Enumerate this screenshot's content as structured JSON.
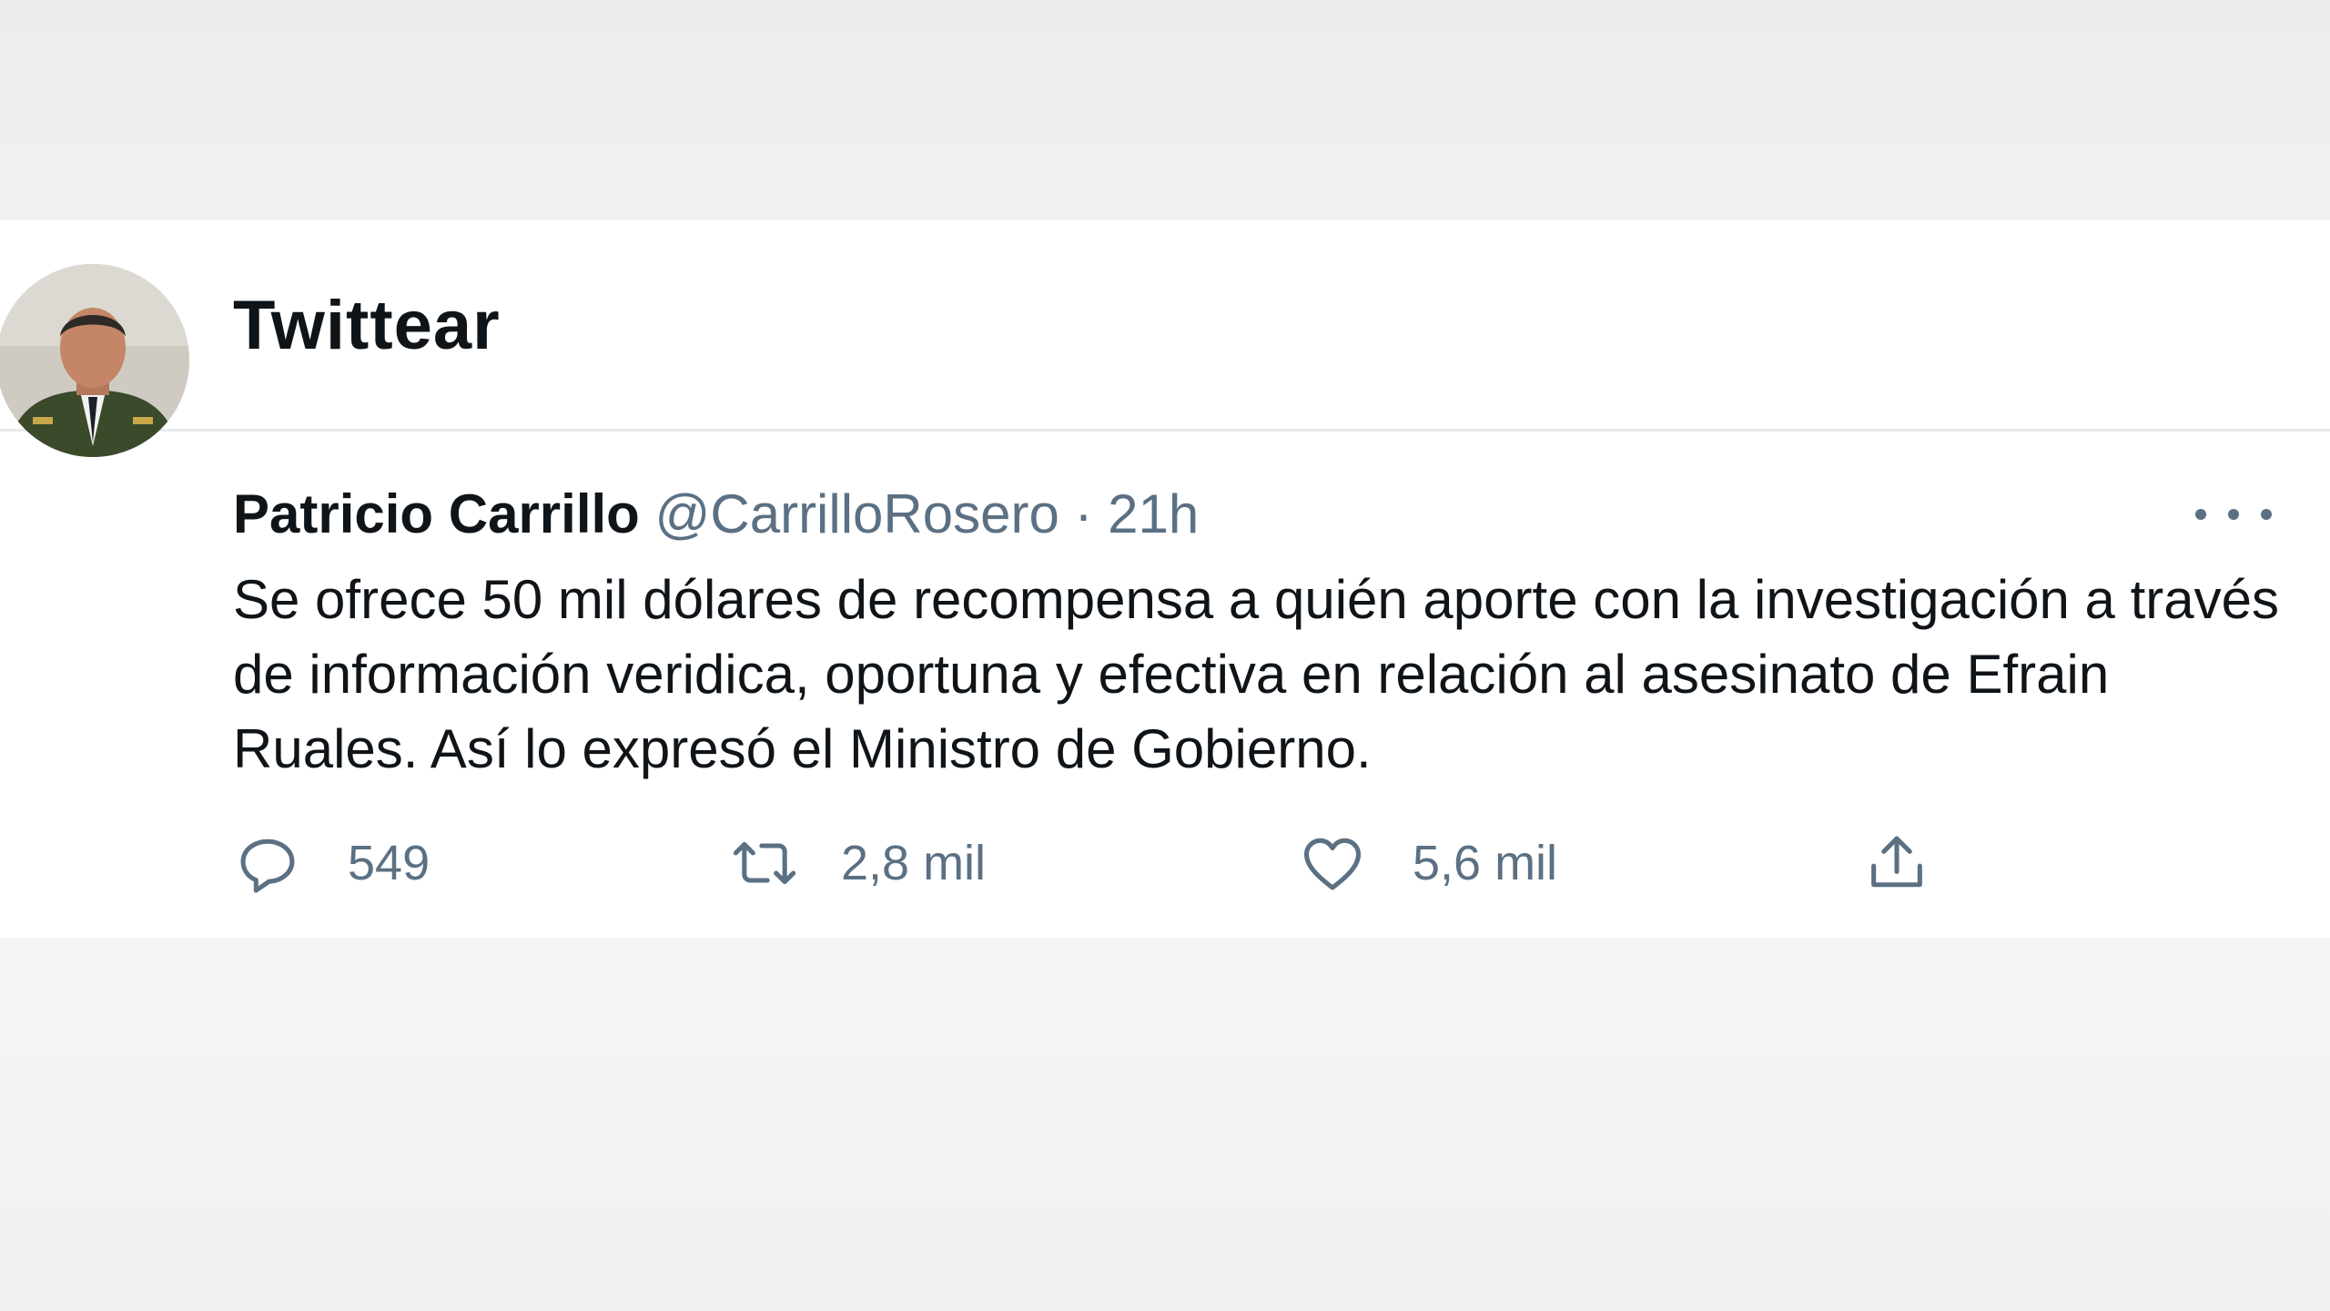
{
  "header": {
    "title": "Twittear",
    "back_icon": "arrow-left-icon",
    "accent_color": "#1d9bf0"
  },
  "tweet": {
    "author_name": "Patricio Carrillo",
    "author_handle": "@CarrilloRosero",
    "separator": "·",
    "timestamp": "21h",
    "text": "Se ofrece 50 mil dólares de recompensa a quién aporte con la investigación a través de información veridica, oportuna y efectiva en relación al asesinato de Efrain Ruales. Así lo expresó el Ministro de Gobierno.",
    "more_icon": "more-horizontal-icon",
    "actions": {
      "reply": {
        "icon": "reply-icon",
        "count": "549"
      },
      "retweet": {
        "icon": "retweet-icon",
        "count": "2,8 mil"
      },
      "like": {
        "icon": "heart-icon",
        "count": "5,6 mil"
      },
      "share": {
        "icon": "share-icon"
      }
    }
  }
}
